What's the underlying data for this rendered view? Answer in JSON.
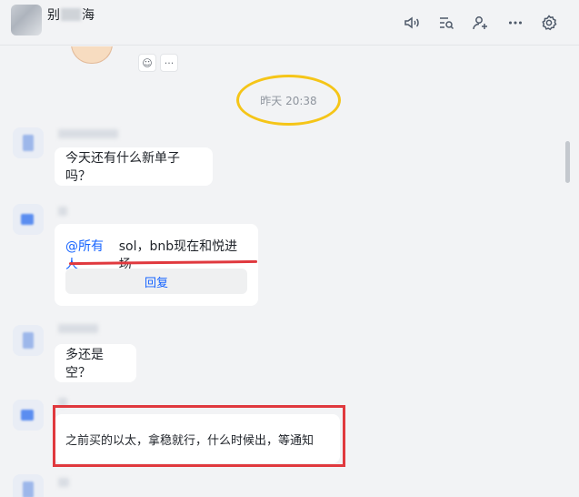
{
  "header": {
    "title_left": "别",
    "title_right": "海"
  },
  "timeline": {
    "timestamp": "昨天 20:38"
  },
  "messages": [
    {
      "text": "今天还有什么新单子吗？"
    },
    {
      "mention": "@所有人",
      "text": "sol，bnb现在和悦进场",
      "reply_label": "回复"
    },
    {
      "text": "多还是空？"
    },
    {
      "text": "之前买的以太，拿稳就行，什么时候出，等通知"
    }
  ],
  "colors": {
    "accent": "#1664ff",
    "highlight_ellipse": "#f5c518",
    "annotation_red": "#e0393e"
  },
  "icons": [
    "speaker-icon",
    "search-chat-icon",
    "add-member-icon",
    "more-icon",
    "settings-icon",
    "reaction-icon"
  ]
}
